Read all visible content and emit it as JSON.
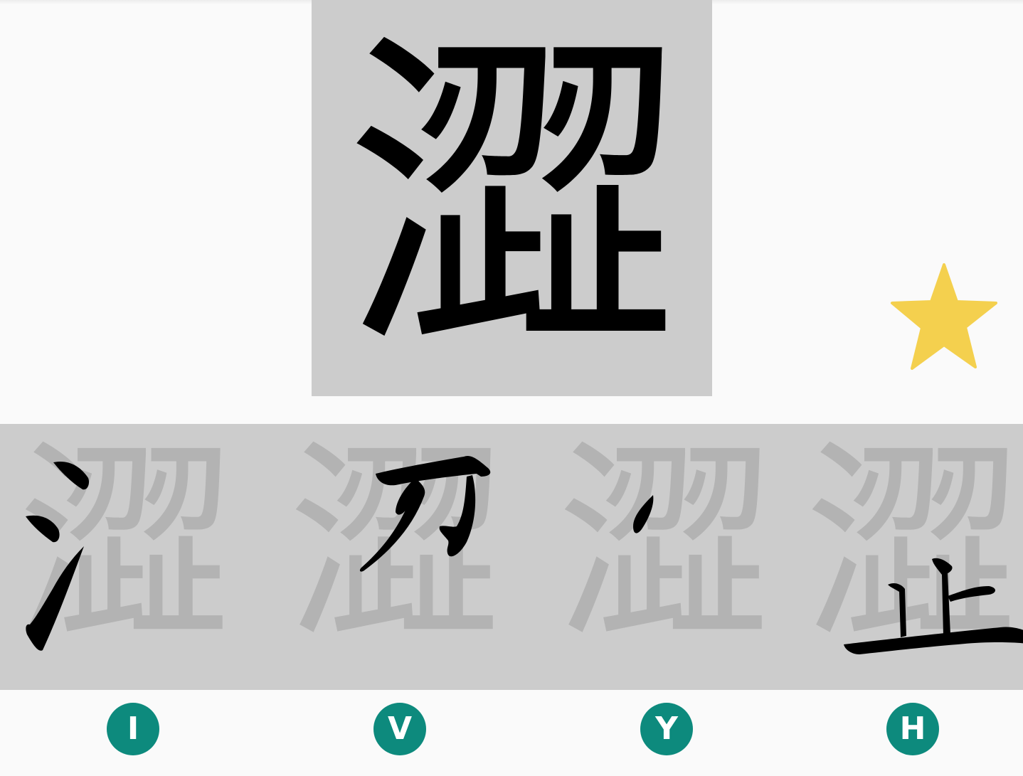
{
  "quiz": {
    "character": "澀",
    "options": [
      {
        "letter": "I",
        "ghost": "澀"
      },
      {
        "letter": "V",
        "ghost": "澀"
      },
      {
        "letter": "Y",
        "ghost": "澀"
      },
      {
        "letter": "H",
        "ghost": "澀"
      }
    ]
  },
  "favorite": {
    "icon": "star-icon",
    "color": "#f4d04e"
  },
  "colors": {
    "background": "#fafafa",
    "panel": "#cccccc",
    "ghost": "#b3b3b3",
    "ink": "#000000",
    "badge": "#0d8a7d"
  }
}
